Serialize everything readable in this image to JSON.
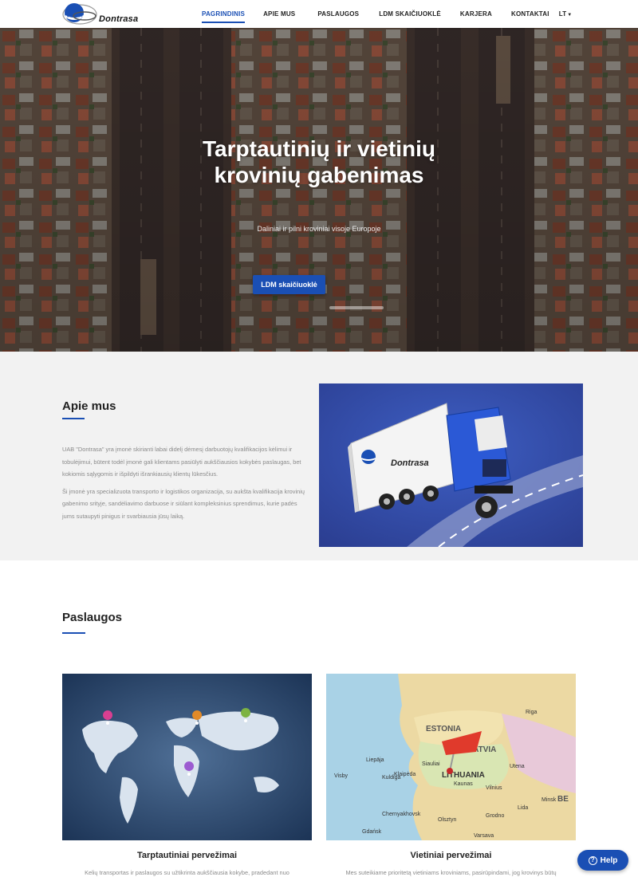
{
  "header": {
    "logo_text": "Dontrasa",
    "nav": [
      {
        "label": "PAGRINDINIS",
        "active": true
      },
      {
        "label": "APIE MUS"
      },
      {
        "label": "PASLAUGOS"
      },
      {
        "label": "LDM SKAIČIUOKLĖ"
      },
      {
        "label": "KARJERA"
      },
      {
        "label": "KONTAKTAI"
      }
    ],
    "lang": "LT"
  },
  "hero": {
    "title_line1": "Tarptautinių ir vietinių",
    "title_line2": "krovinių gabenimas",
    "subtitle": "Daliniai ir pilni kroviniai visoje Europoje",
    "button": "LDM skaičiuoklė"
  },
  "about": {
    "title": "Apie mus",
    "paragraph1": "UAB \"Dontrasa\" yra įmonė skirianti labai didelį dėmesį darbuotojų kvalifikacijos kėlimui ir tobulėjimui, būtent todėl įmonė gali klientams pasiūlyti aukščiausios kokybės paslaugas, bet kokiomis sąlygomis ir išpildyti išrankiausių klientų lūkesčius.",
    "paragraph2": "Ši įmonė yra specializuota transporto ir logistikos organizacija, su aukšta kvalifikacija krovinių gabenimo srityje, sandėliavimo darbuose ir siūlant kompleksinius sprendimus, kurie padės jums sutaupyti pinigus ir svarbiausia jūsų laiką.",
    "image_logo_text": "Dontrasa"
  },
  "services": {
    "title": "Paslaugos",
    "cards": [
      {
        "title": "Tarptautiniai pervežimai",
        "text": "Kelių transportas ir paslaugos su užtikrinta aukščiausia kokybe, pradedant nuo"
      },
      {
        "title": "Vietiniai pervežimai",
        "text": "Mes suteikiame prioritetą vietiniams kroviniams, pasirūpindami, jog krovinys būtų"
      }
    ],
    "map_labels": [
      "ESTONIA",
      "LATVIA",
      "LITHUANIA",
      "Vilnius",
      "Kaunas",
      "Riga",
      "Chernyakhovsk",
      "Olsztyn",
      "Gdańsk",
      "Varsava",
      "Klaipėda",
      "Visby",
      "Kuldiga",
      "Liepāja",
      "Siauliai",
      "Utena",
      "Lida",
      "Grodno",
      "Minsk",
      "BE"
    ]
  },
  "help": {
    "label": "Help"
  }
}
